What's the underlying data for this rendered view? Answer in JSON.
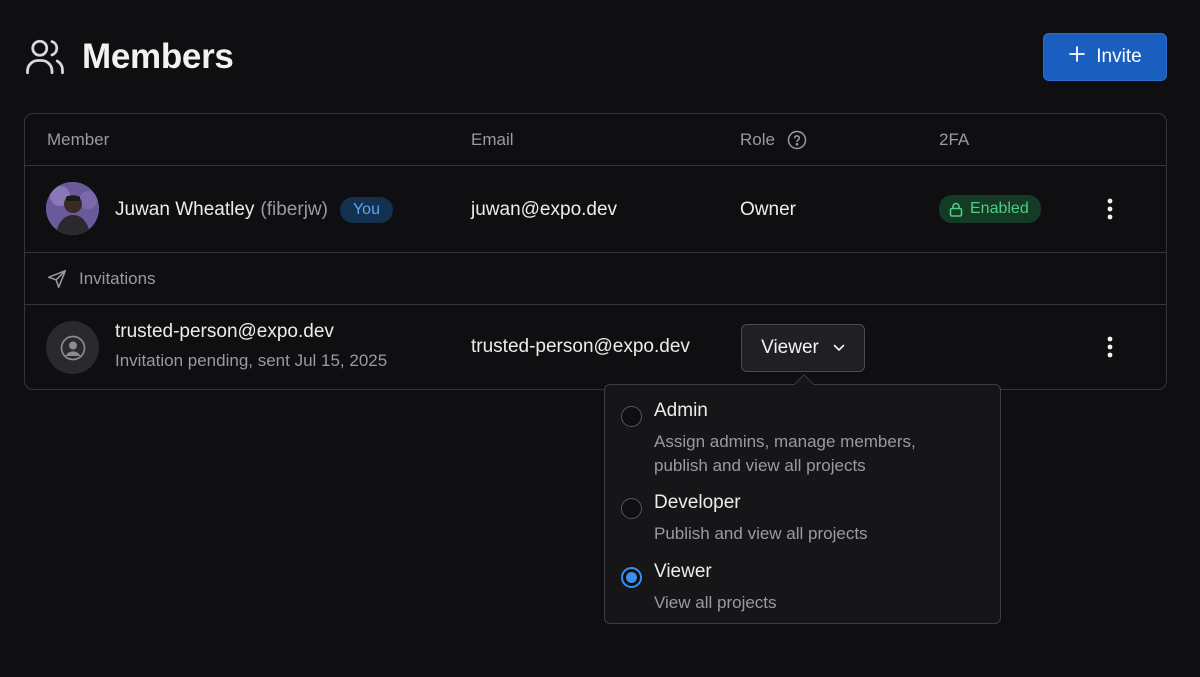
{
  "header": {
    "title": "Members",
    "title_icon": "users-icon",
    "invite_label": "Invite"
  },
  "table": {
    "columns": {
      "member": "Member",
      "email": "Email",
      "role": "Role",
      "twofa": "2FA"
    },
    "member_row": {
      "name": "Juwan Wheatley",
      "handle": "(fiberjw)",
      "you_badge": "You",
      "email": "juwan@expo.dev",
      "role": "Owner",
      "twofa_status": "Enabled"
    },
    "invitations_label": "Invitations",
    "invite_row": {
      "email": "trusted-person@expo.dev",
      "status": "Invitation pending, sent Jul 15, 2025",
      "email_col": "trusted-person@expo.dev",
      "role_selected": "Viewer"
    }
  },
  "role_dropdown": {
    "options": [
      {
        "label": "Admin",
        "description": "Assign admins, manage members, publish and view all projects",
        "selected": false
      },
      {
        "label": "Developer",
        "description": "Publish and view all projects",
        "selected": false
      },
      {
        "label": "Viewer",
        "description": "View all projects",
        "selected": true
      }
    ]
  },
  "colors": {
    "background": "#0f0f11",
    "accent": "#1a5fbf",
    "success": "#4ccf82",
    "radio_checked": "#3a8ef0"
  }
}
